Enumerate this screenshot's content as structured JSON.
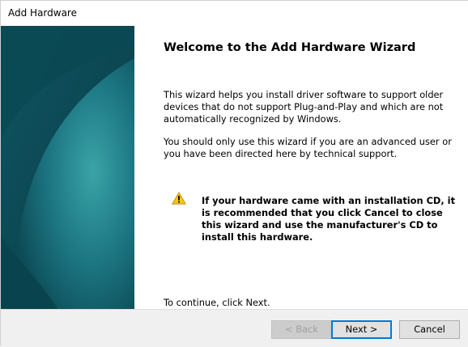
{
  "window": {
    "title": "Add Hardware"
  },
  "wizard": {
    "heading": "Welcome to the Add Hardware Wizard",
    "paragraph_1": "This wizard helps you install driver software to support older devices that do not support Plug-and-Play and which are not automatically recognized by Windows.",
    "paragraph_2": "You should only use this wizard if you are an advanced user or you have been directed here by technical support.",
    "warning_text": "If your hardware came with an installation CD, it is recommended that you click Cancel to close this wizard and use the manufacturer's CD to install this hardware.",
    "continue_text": "To continue, click Next."
  },
  "buttons": {
    "back_label": "< Back",
    "next_label": "Next >",
    "cancel_label": "Cancel"
  },
  "icons": {
    "warning": "warning-icon"
  },
  "colors": {
    "side_panel_dark": "#0a3f4a",
    "side_panel_light": "#2b8f97",
    "accent": "#0078d7",
    "warning_yellow": "#f5c518"
  }
}
